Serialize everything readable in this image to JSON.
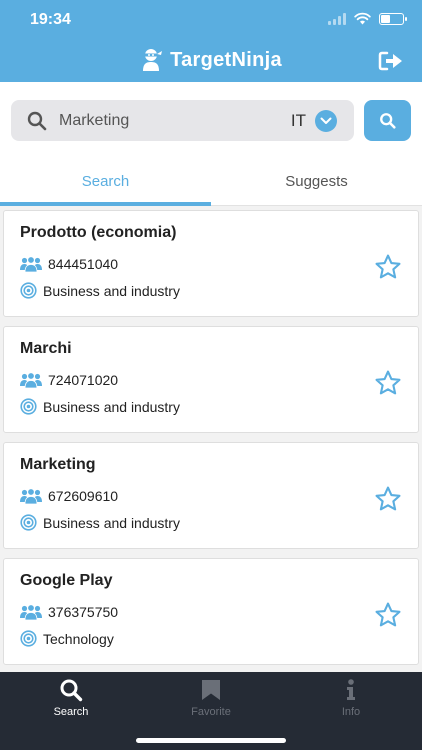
{
  "status_bar": {
    "time": "19:34",
    "signal_icon": "cellular-signal-icon",
    "wifi_icon": "wifi-icon",
    "battery_icon": "battery-icon",
    "battery_level": 0.4
  },
  "header": {
    "title": "TargetNinja",
    "logo_icon": "ninja-logo-icon",
    "logout_icon": "logout-icon"
  },
  "search": {
    "query": "Marketing",
    "language": "IT",
    "search_icon": "search-icon",
    "dropdown_icon": "chevron-down-icon"
  },
  "tabs": [
    {
      "label": "Search",
      "active": true
    },
    {
      "label": "Suggests",
      "active": false
    }
  ],
  "results": [
    {
      "title": "Prodotto (economia)",
      "audience": "844451040",
      "category": "Business and industry"
    },
    {
      "title": "Marchi",
      "audience": "724071020",
      "category": "Business and industry"
    },
    {
      "title": "Marketing",
      "audience": "672609610",
      "category": "Business and industry"
    },
    {
      "title": "Google Play",
      "audience": "376375750",
      "category": "Technology"
    }
  ],
  "tab_bar": [
    {
      "label": "Search",
      "icon": "search-icon",
      "active": true
    },
    {
      "label": "Favorite",
      "icon": "bookmark-icon",
      "active": false
    },
    {
      "label": "Info",
      "icon": "info-icon",
      "active": false
    }
  ],
  "colors": {
    "accent": "#5aaee0",
    "tab_bar_bg": "#252b35",
    "page_bg": "#f2f2f2"
  }
}
